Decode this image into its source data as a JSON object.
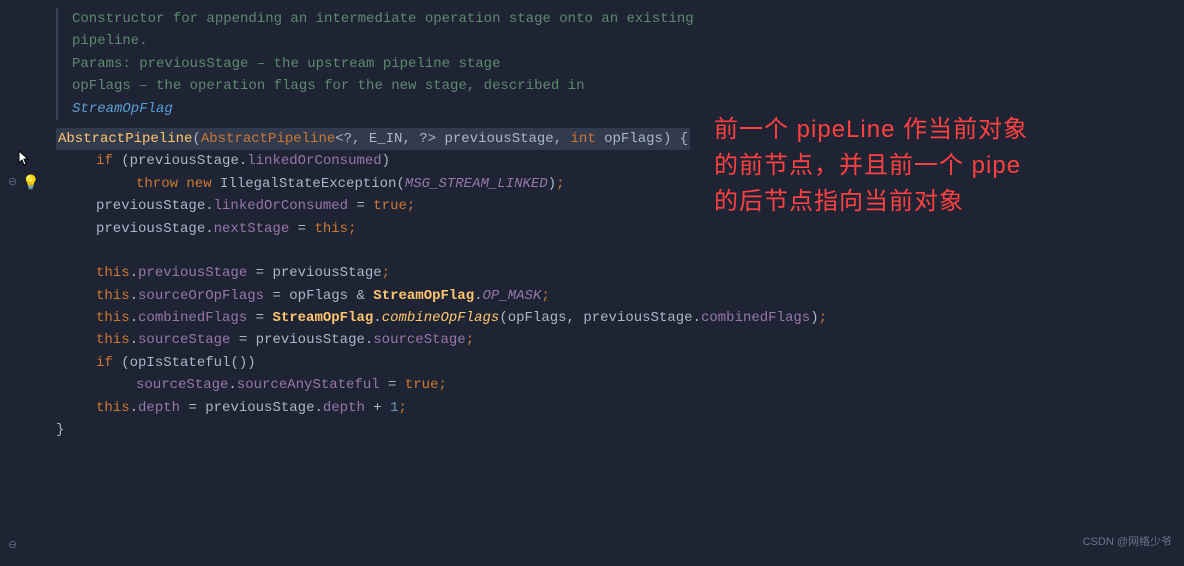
{
  "doc": {
    "line1": "Constructor for appending an intermediate operation stage onto an existing",
    "line2": "pipeline.",
    "params_label": "Params:",
    "param1": " previousStage – the upstream pipeline stage",
    "param2_indent": "        ",
    "param2": "opFlags – the operation flags for the new stage, described in",
    "link_indent": "        ",
    "link": "StreamOpFlag"
  },
  "signature": {
    "method_name": "AbstractPipeline",
    "param_type": "AbstractPipeline",
    "generics": "<?, E_IN, ?>",
    "param1_name": " previousStage",
    "comma": ", ",
    "param2_type": "int ",
    "param2_name": "opFlags",
    "close": ") {"
  },
  "body": {
    "l1_if": "if ",
    "l1_open": "(",
    "l1_var": "previousStage",
    "l1_dot": ".",
    "l1_field": "linkedOrConsumed",
    "l1_close": ")",
    "l2_throw": "throw new ",
    "l2_class": "IllegalStateException",
    "l2_open": "(",
    "l2_const": "MSG_STREAM_LINKED",
    "l2_close": ")",
    "l2_semi": ";",
    "l3_var": "previousStage",
    "l3_dot": ".",
    "l3_field": "linkedOrConsumed",
    "l3_eq": " = ",
    "l3_val": "true",
    "l3_semi": ";",
    "l4_var": "previousStage",
    "l4_dot": ".",
    "l4_field": "nextStage",
    "l4_eq": " = ",
    "l4_val": "this",
    "l4_semi": ";",
    "l5_this": "this",
    "l5_dot": ".",
    "l5_field": "previousStage",
    "l5_eq": " = ",
    "l5_val": "previousStage",
    "l5_semi": ";",
    "l6_this": "this",
    "l6_dot": ".",
    "l6_field": "sourceOrOpFlags",
    "l6_eq": " = ",
    "l6_val": "opFlags",
    "l6_amp": " & ",
    "l6_class": "StreamOpFlag",
    "l6_dot2": ".",
    "l6_const": "OP_MASK",
    "l6_semi": ";",
    "l7_this": "this",
    "l7_dot": ".",
    "l7_field": "combinedFlags",
    "l7_eq": " = ",
    "l7_class": "StreamOpFlag",
    "l7_dot2": ".",
    "l7_method": "combineOpFlags",
    "l7_open": "(",
    "l7_arg1": "opFlags",
    "l7_comma": ", ",
    "l7_arg2": "previousStage",
    "l7_dot3": ".",
    "l7_arg2f": "combinedFlags",
    "l7_close": ")",
    "l7_semi": ";",
    "l8_this": "this",
    "l8_dot": ".",
    "l8_field": "sourceStage",
    "l8_eq": " = ",
    "l8_val": "previousStage",
    "l8_dot2": ".",
    "l8_field2": "sourceStage",
    "l8_semi": ";",
    "l9_if": "if ",
    "l9_open": "(",
    "l9_method": "opIsStateful",
    "l9_paren": "()",
    "l9_close": ")",
    "l10_var": "sourceStage",
    "l10_dot": ".",
    "l10_field": "sourceAnyStateful",
    "l10_eq": " = ",
    "l10_val": "true",
    "l10_semi": ";",
    "l11_this": "this",
    "l11_dot": ".",
    "l11_field": "depth",
    "l11_eq": " = ",
    "l11_val": "previousStage",
    "l11_dot2": ".",
    "l11_field2": "depth",
    "l11_plus": " + ",
    "l11_num": "1",
    "l11_semi": ";",
    "close_brace": "}"
  },
  "annotation": {
    "line1": "前一个 pipeLine 作当前对象",
    "line2": "的前节点，并且前一个 pipe",
    "line3": "的后节点指向当前对象"
  },
  "watermark": "CSDN @网络少爷"
}
